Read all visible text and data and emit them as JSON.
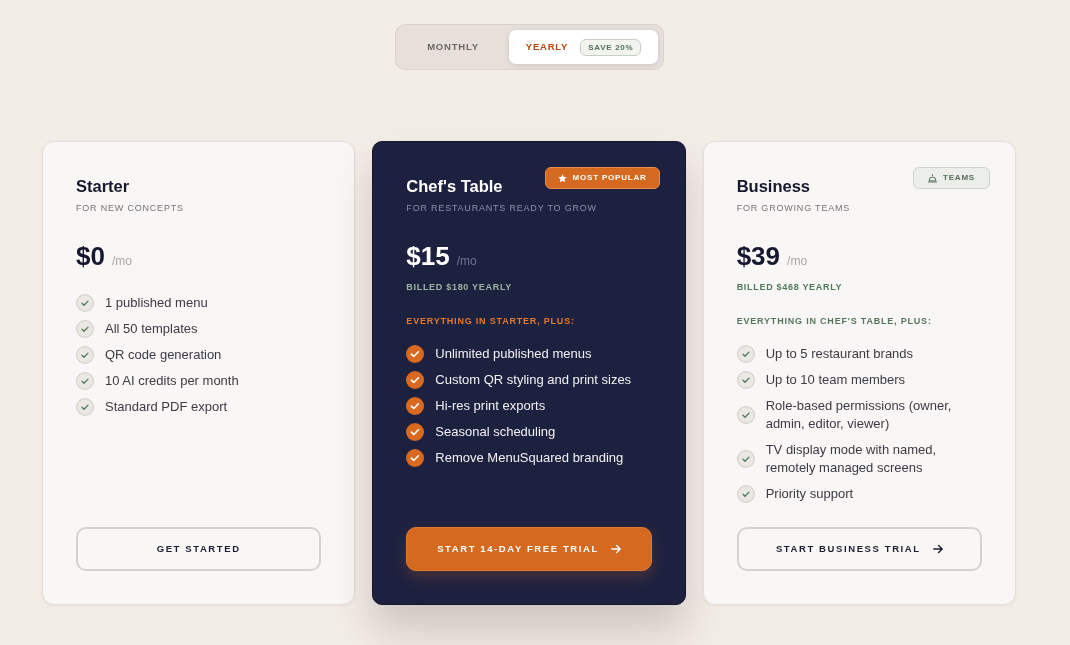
{
  "billing_toggle": {
    "options": [
      {
        "label": "MONTHLY",
        "selected": false
      },
      {
        "label": "YEARLY",
        "selected": true,
        "badge": "SAVE 20%"
      }
    ]
  },
  "plans": [
    {
      "kind": "standard",
      "name": "Starter",
      "tagline": "FOR NEW CONCEPTS",
      "price": "$0",
      "period": "/mo",
      "features": [
        "1 published menu",
        "All 50 templates",
        "QR code generation",
        "10 AI credits per month",
        "Standard PDF export"
      ],
      "button": {
        "label": "GET STARTED",
        "arrow": false
      }
    },
    {
      "kind": "featured",
      "name": "Chef's Table",
      "badge": {
        "kind": "popular",
        "label": "MOST POPULAR"
      },
      "tagline": "FOR RESTAURANTS READY TO GROW",
      "price": "$15",
      "period": "/mo",
      "billing_note": "BILLED $180 YEARLY",
      "features_heading": "EVERYTHING IN STARTER, PLUS:",
      "features": [
        "Unlimited published menus",
        "Custom QR styling and print sizes",
        "Hi-res print exports",
        "Seasonal scheduling",
        "Remove MenuSquared branding"
      ],
      "button": {
        "label": "START 14-DAY FREE TRIAL",
        "arrow": true
      }
    },
    {
      "kind": "standard",
      "name": "Business",
      "badge": {
        "kind": "teams",
        "label": "TEAMS"
      },
      "tagline": "FOR GROWING TEAMS",
      "price": "$39",
      "period": "/mo",
      "billing_note": "BILLED $468 YEARLY",
      "features_heading": "EVERYTHING IN CHEF'S TABLE, PLUS:",
      "features": [
        "Up to 5 restaurant brands",
        "Up to 10 team members",
        "Role-based permissions (owner, admin, editor, viewer)",
        "TV display mode with named, remotely managed screens",
        "Priority support"
      ],
      "button": {
        "label": "START BUSINESS TRIAL",
        "arrow": true
      }
    }
  ]
}
